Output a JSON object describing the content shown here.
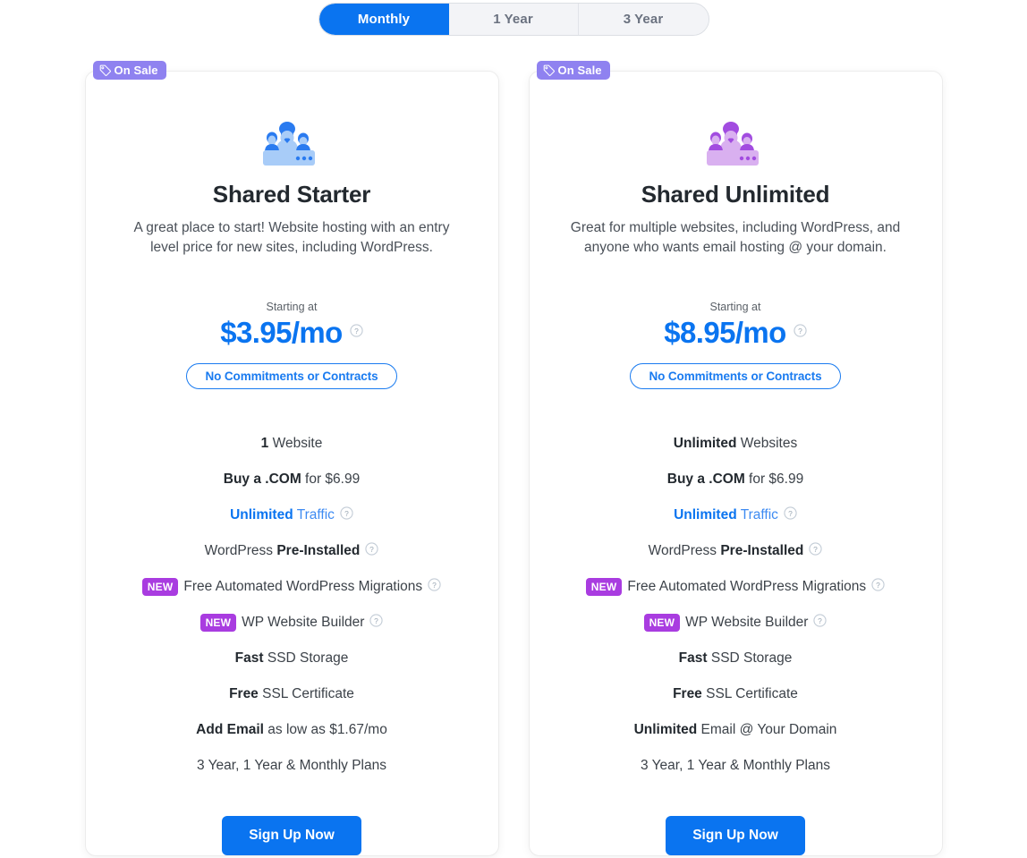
{
  "term_switch": {
    "options": [
      {
        "label": "Monthly",
        "active": true
      },
      {
        "label": "1 Year",
        "active": false
      },
      {
        "label": "3 Year",
        "active": false
      }
    ]
  },
  "colors": {
    "accent_blue": "#0a74f0",
    "sale_badge_purple": "#8f82f0",
    "new_badge_purple": "#a93ce0",
    "inactive_tab_bg": "#f3f4f7",
    "text_dark": "#23292f"
  },
  "plans": [
    {
      "sale_badge": "On Sale",
      "icon": "group-people-icon",
      "icon_color": "#2a7bf0",
      "icon_color_light": "#a8ccf8",
      "title": "Shared Starter",
      "description": "A great place to start! Website hosting with an entry level price for new sites, including WordPress.",
      "starting_at": "Starting at",
      "price": "$3.95/mo",
      "price_tooltip": "?",
      "commitment_label": "No Commitments or Contracts",
      "features": [
        {
          "parts": [
            {
              "text": "1",
              "style": "bold"
            },
            {
              "text": " Website",
              "style": "normal"
            }
          ],
          "tooltip": false,
          "badge": null
        },
        {
          "parts": [
            {
              "text": "Buy a .COM",
              "style": "bold"
            },
            {
              "text": " for $6.99",
              "style": "normal"
            }
          ],
          "tooltip": false,
          "badge": null
        },
        {
          "parts": [
            {
              "text": "Unlimited",
              "style": "blue-bold"
            },
            {
              "text": " Traffic",
              "style": "blue-light"
            }
          ],
          "tooltip": true,
          "badge": null
        },
        {
          "parts": [
            {
              "text": "WordPress ",
              "style": "normal"
            },
            {
              "text": "Pre-Installed",
              "style": "bold"
            }
          ],
          "tooltip": true,
          "badge": null
        },
        {
          "parts": [
            {
              "text": "Free Automated WordPress Migrations",
              "style": "normal"
            }
          ],
          "tooltip": true,
          "badge": "NEW"
        },
        {
          "parts": [
            {
              "text": "WP Website Builder",
              "style": "normal"
            }
          ],
          "tooltip": true,
          "badge": "NEW"
        },
        {
          "parts": [
            {
              "text": "Fast",
              "style": "bold"
            },
            {
              "text": " SSD Storage",
              "style": "normal"
            }
          ],
          "tooltip": false,
          "badge": null
        },
        {
          "parts": [
            {
              "text": "Free",
              "style": "bold"
            },
            {
              "text": " SSL Certificate",
              "style": "normal"
            }
          ],
          "tooltip": false,
          "badge": null
        },
        {
          "parts": [
            {
              "text": "Add Email",
              "style": "bold"
            },
            {
              "text": " as low as $1.67/mo",
              "style": "normal"
            }
          ],
          "tooltip": false,
          "badge": null
        },
        {
          "parts": [
            {
              "text": "3 Year, 1 Year & Monthly Plans",
              "style": "normal"
            }
          ],
          "tooltip": false,
          "badge": null
        }
      ],
      "signup_label": "Sign Up Now"
    },
    {
      "sale_badge": "On Sale",
      "icon": "group-people-icon",
      "icon_color": "#a24ce0",
      "icon_color_light": "#d9b0f0",
      "title": "Shared Unlimited",
      "description": "Great for multiple websites, including WordPress, and anyone who wants email hosting @ your domain.",
      "starting_at": "Starting at",
      "price": "$8.95/mo",
      "price_tooltip": "?",
      "commitment_label": "No Commitments or Contracts",
      "features": [
        {
          "parts": [
            {
              "text": "Unlimited",
              "style": "bold"
            },
            {
              "text": " Websites",
              "style": "normal"
            }
          ],
          "tooltip": false,
          "badge": null
        },
        {
          "parts": [
            {
              "text": "Buy a .COM",
              "style": "bold"
            },
            {
              "text": " for $6.99",
              "style": "normal"
            }
          ],
          "tooltip": false,
          "badge": null
        },
        {
          "parts": [
            {
              "text": "Unlimited",
              "style": "blue-bold"
            },
            {
              "text": " Traffic",
              "style": "blue-light"
            }
          ],
          "tooltip": true,
          "badge": null
        },
        {
          "parts": [
            {
              "text": "WordPress ",
              "style": "normal"
            },
            {
              "text": "Pre-Installed",
              "style": "bold"
            }
          ],
          "tooltip": true,
          "badge": null
        },
        {
          "parts": [
            {
              "text": "Free Automated WordPress Migrations",
              "style": "normal"
            }
          ],
          "tooltip": true,
          "badge": "NEW"
        },
        {
          "parts": [
            {
              "text": "WP Website Builder",
              "style": "normal"
            }
          ],
          "tooltip": true,
          "badge": "NEW"
        },
        {
          "parts": [
            {
              "text": "Fast",
              "style": "bold"
            },
            {
              "text": " SSD Storage",
              "style": "normal"
            }
          ],
          "tooltip": false,
          "badge": null
        },
        {
          "parts": [
            {
              "text": "Free",
              "style": "bold"
            },
            {
              "text": " SSL Certificate",
              "style": "normal"
            }
          ],
          "tooltip": false,
          "badge": null
        },
        {
          "parts": [
            {
              "text": "Unlimited",
              "style": "bold"
            },
            {
              "text": " Email @ Your Domain",
              "style": "normal"
            }
          ],
          "tooltip": false,
          "badge": null
        },
        {
          "parts": [
            {
              "text": "3 Year, 1 Year & Monthly Plans",
              "style": "normal"
            }
          ],
          "tooltip": false,
          "badge": null
        }
      ],
      "signup_label": "Sign Up Now"
    }
  ]
}
